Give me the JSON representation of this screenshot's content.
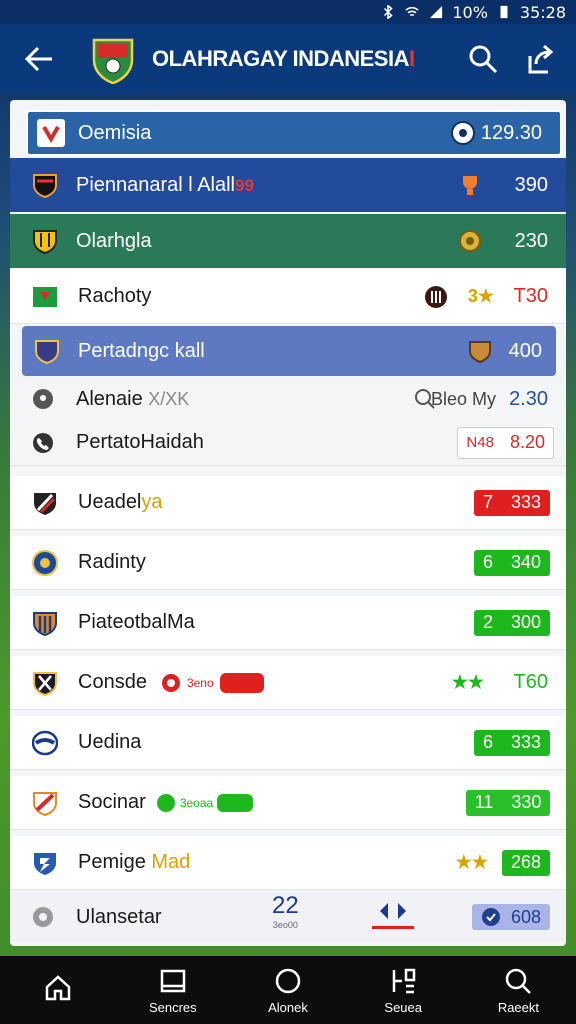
{
  "status": {
    "battery": "10%",
    "time": "35:28"
  },
  "header": {
    "title_main": "OLAHRAGAY INDANESIA",
    "title_accent": "I"
  },
  "top_rows": [
    {
      "name": "Oemisia",
      "value": "129.30"
    },
    {
      "name": "Piennanaral l Alall",
      "badge": "99",
      "value": "390"
    },
    {
      "name": "Olarhgla",
      "value": "230"
    }
  ],
  "rows": [
    {
      "name": "Rachoty",
      "value": "T30",
      "prefix": "3★"
    },
    {
      "name": "Pertadngc kall",
      "value": "400"
    },
    {
      "name": "Alenaie",
      "suffix": "X/XK",
      "sub": "Bleo My",
      "value": "2.30"
    },
    {
      "name": "PertatoHaidah",
      "code": "N48",
      "value": "8.20"
    },
    {
      "name": "Ueadel",
      "name_accent": "ya",
      "pill_a": "7",
      "pill_b": "333"
    },
    {
      "name": "Radinty",
      "pill_a": "6",
      "pill_b": "340"
    },
    {
      "name": "PiateotbalMa",
      "pill_a": "2",
      "pill_b": "300"
    },
    {
      "name": "Consde",
      "chip": "3eno",
      "star": "★★",
      "value": "T60"
    },
    {
      "name": "Uedina",
      "pill_a": "6",
      "pill_b": "333"
    },
    {
      "name": "Socinar",
      "chip": "3eoaa",
      "pill_a": "11",
      "pill_b": "330"
    },
    {
      "name": "Pemige",
      "name_accent": " Mad",
      "star": "★★",
      "value": "268"
    },
    {
      "name": "Ulansetar",
      "big_num": "22",
      "tiny": "3eo00",
      "value": "608"
    }
  ],
  "nav": [
    {
      "label": "",
      "icon": "home-icon"
    },
    {
      "label": "Sencres",
      "icon": "scores-icon"
    },
    {
      "label": "Alonek",
      "icon": "circle-icon"
    },
    {
      "label": "Seuea",
      "icon": "list-icon"
    },
    {
      "label": "Raeekt",
      "icon": "search-icon"
    }
  ],
  "colors": {
    "appbar": "#0b3a7c",
    "accent_red": "#e01f1f",
    "accent_green": "#1eb81e",
    "highlight": "#5d79c2"
  }
}
